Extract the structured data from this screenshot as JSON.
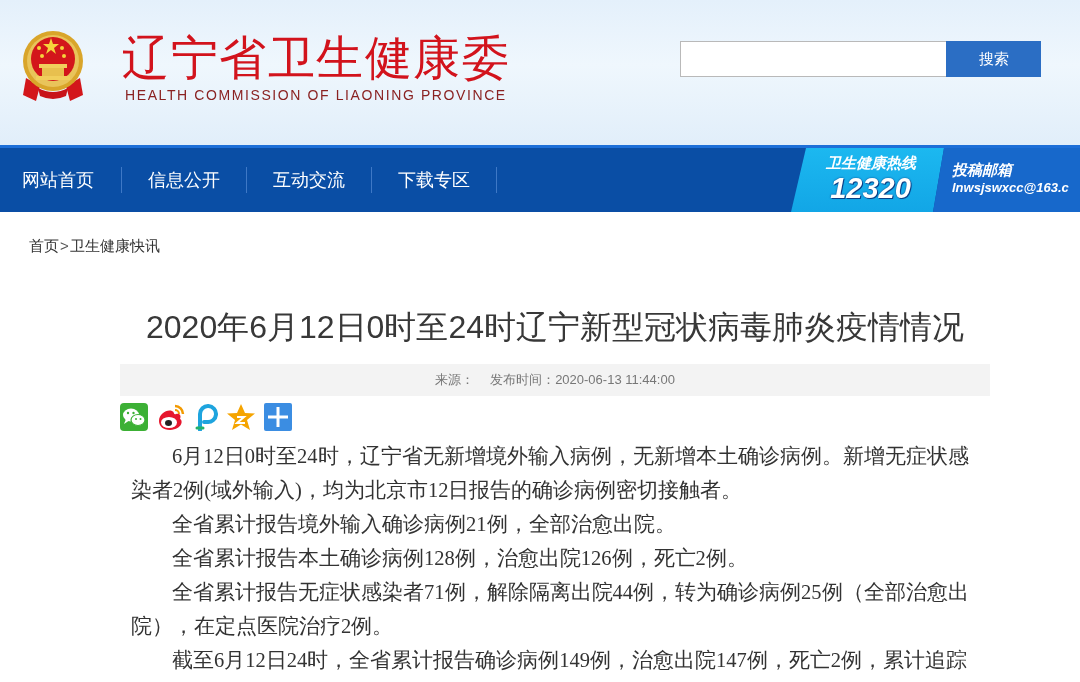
{
  "header": {
    "title": "辽宁省卫生健康委",
    "subtitle": "HEALTH COMMISSION OF LIAONING PROVINCE",
    "search_button": "搜索"
  },
  "nav": {
    "items": [
      {
        "label": "网站首页"
      },
      {
        "label": "信息公开"
      },
      {
        "label": "互动交流"
      },
      {
        "label": "下载专区"
      }
    ],
    "hotline": {
      "label": "卫生健康热线",
      "number": "12320"
    },
    "mailbox": {
      "label": "投稿邮箱",
      "address": "lnwsjswxcc@163.c"
    }
  },
  "breadcrumb": {
    "items": [
      "首页",
      "卫生健康快讯"
    ],
    "separator": ">"
  },
  "article": {
    "title": "2020年6月12日0时至24时辽宁新型冠状病毒肺炎疫情情况",
    "source_label": "来源：",
    "published": "发布时间：2020-06-13 11:44:00",
    "paragraphs": [
      "6月12日0时至24时，辽宁省无新增境外输入病例，无新增本土确诊病例。新增无症状感染者2例(域外输入)，均为北京市12日报告的确诊病例密切接触者。",
      "全省累计报告境外输入确诊病例21例，全部治愈出院。",
      "全省累计报告本土确诊病例128例，治愈出院126例，死亡2例。",
      "全省累计报告无症状感染者71例，解除隔离出院44例，转为确诊病例25例（全部治愈出院），在定点医院治疗2例。",
      "截至6月12日24时，全省累计报告确诊病例149例，治愈出院147例，死亡2例，累计追踪"
    ]
  }
}
